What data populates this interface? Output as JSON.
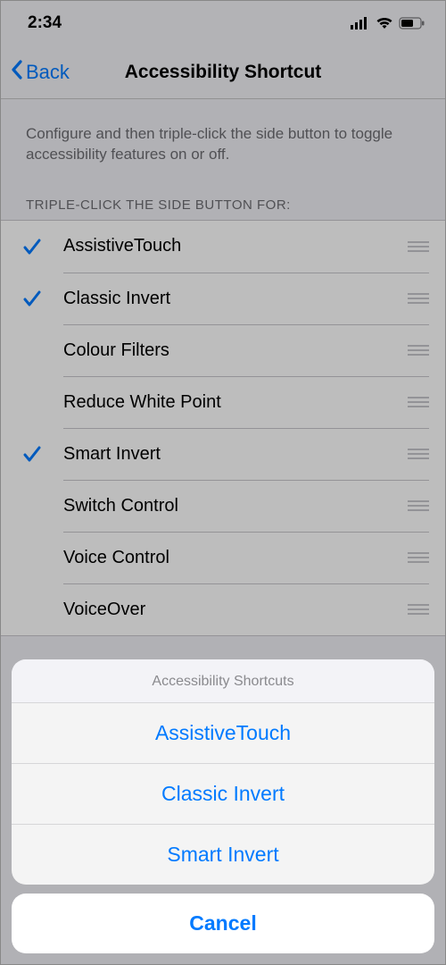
{
  "status": {
    "time": "2:34"
  },
  "nav": {
    "back": "Back",
    "title": "Accessibility Shortcut"
  },
  "description": "Configure and then triple-click the side button to toggle accessibility features on or off.",
  "section_header": "TRIPLE-CLICK THE SIDE BUTTON FOR:",
  "rows": [
    {
      "label": "AssistiveTouch",
      "checked": true
    },
    {
      "label": "Classic Invert",
      "checked": true
    },
    {
      "label": "Colour Filters",
      "checked": false
    },
    {
      "label": "Reduce White Point",
      "checked": false
    },
    {
      "label": "Smart Invert",
      "checked": true
    },
    {
      "label": "Switch Control",
      "checked": false
    },
    {
      "label": "Voice Control",
      "checked": false
    },
    {
      "label": "VoiceOver",
      "checked": false
    }
  ],
  "sheet": {
    "title": "Accessibility Shortcuts",
    "items": [
      "AssistiveTouch",
      "Classic Invert",
      "Smart Invert"
    ],
    "cancel": "Cancel"
  },
  "colors": {
    "accent": "#007aff"
  }
}
